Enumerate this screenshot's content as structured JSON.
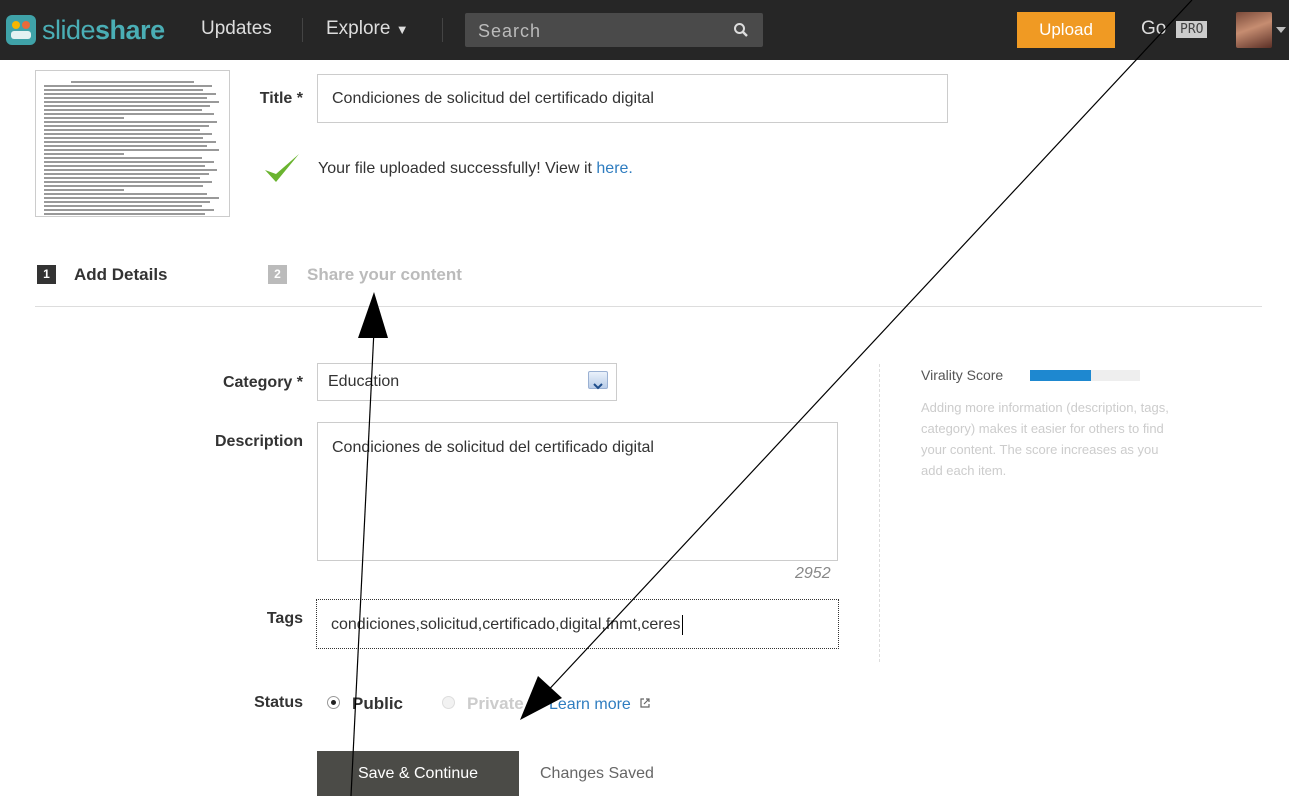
{
  "nav": {
    "logo_text_light": "slide",
    "logo_text_bold": "share",
    "updates_label": "Updates",
    "explore_label": "Explore",
    "search_placeholder": "Search",
    "upload_label": "Upload",
    "go_label": "Go",
    "pro_badge": "PRO"
  },
  "upload": {
    "title_label": "Title *",
    "title_value": "Condiciones de solicitud del certificado digital",
    "success_text": "Your file uploaded successfully! View it ",
    "success_link": "here."
  },
  "steps": [
    {
      "num": "1",
      "label": "Add Details",
      "active": true
    },
    {
      "num": "2",
      "label": "Share your content",
      "active": false
    }
  ],
  "form": {
    "category_label": "Category *",
    "category_value": "Education",
    "description_label": "Description",
    "description_value": "Condiciones de solicitud del certificado digital",
    "char_count": "2952",
    "tags_label": "Tags",
    "tags_value": "condiciones,solicitud,certificado,digital,fnmt,ceres",
    "status_label": "Status",
    "status_public": "Public",
    "status_private": "Private",
    "learn_more": "Learn more",
    "save_button": "Save & Continue",
    "changes_saved": "Changes Saved"
  },
  "virality": {
    "label": "Virality Score",
    "score_fraction": 0.55,
    "help_text": "Adding more information (description, tags, category) makes it easier for others to find your content. The score increases as you add each item."
  },
  "colors": {
    "topbar": "#262626",
    "brand": "#4aaeb5",
    "upload": "#f09a23",
    "link": "#2f7dc0",
    "virality": "#1e88d0",
    "step_active": "#333333",
    "step_inactive": "#bbbbbb"
  }
}
